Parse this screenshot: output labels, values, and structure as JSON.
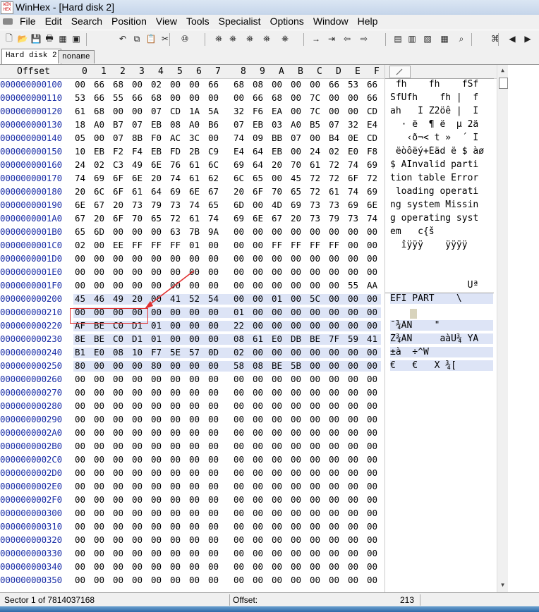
{
  "window": {
    "title": "WinHex - [Hard disk 2]",
    "app_icon_text": "WIN HEX"
  },
  "menu": [
    "File",
    "Edit",
    "Search",
    "Position",
    "View",
    "Tools",
    "Specialist",
    "Options",
    "Window",
    "Help"
  ],
  "tabs": [
    {
      "label": "Hard disk 2",
      "active": true
    },
    {
      "label": "noname",
      "active": false
    }
  ],
  "header": {
    "offset": "Offset",
    "columns": [
      "0",
      "1",
      "2",
      "3",
      "4",
      "5",
      "6",
      "7",
      "8",
      "9",
      "A",
      "B",
      "C",
      "D",
      "E",
      "F"
    ]
  },
  "rows": [
    {
      "offset": "000000000100",
      "bytes": [
        "00",
        "66",
        "68",
        "00",
        "02",
        "00",
        "00",
        "66",
        "68",
        "08",
        "00",
        "00",
        "00",
        "66",
        "53",
        "66"
      ],
      "ascii": " fh    fh    fSf"
    },
    {
      "offset": "000000000110",
      "bytes": [
        "53",
        "66",
        "55",
        "66",
        "68",
        "00",
        "00",
        "00",
        "00",
        "66",
        "68",
        "00",
        "7C",
        "00",
        "00",
        "66"
      ],
      "ascii": "SfUfh    fh |  f"
    },
    {
      "offset": "000000000120",
      "bytes": [
        "61",
        "68",
        "00",
        "00",
        "07",
        "CD",
        "1A",
        "5A",
        "32",
        "F6",
        "EA",
        "00",
        "7C",
        "00",
        "00",
        "CD"
      ],
      "ascii": "ah   Í Z2öê |  Í"
    },
    {
      "offset": "000000000130",
      "bytes": [
        "18",
        "A0",
        "B7",
        "07",
        "EB",
        "08",
        "A0",
        "B6",
        "07",
        "EB",
        "03",
        "A0",
        "B5",
        "07",
        "32",
        "E4"
      ],
      "ascii": "  · ë  ¶ ë  µ 2ä"
    },
    {
      "offset": "000000000140",
      "bytes": [
        "05",
        "00",
        "07",
        "8B",
        "F0",
        "AC",
        "3C",
        "00",
        "74",
        "09",
        "BB",
        "07",
        "00",
        "B4",
        "0E",
        "CD"
      ],
      "ascii": "   ‹ð¬< t »  ´ Í"
    },
    {
      "offset": "000000000150",
      "bytes": [
        "10",
        "EB",
        "F2",
        "F4",
        "EB",
        "FD",
        "2B",
        "C9",
        "E4",
        "64",
        "EB",
        "00",
        "24",
        "02",
        "E0",
        "F8"
      ],
      "ascii": " ëòôëý+Éäd ë $ àø"
    },
    {
      "offset": "000000000160",
      "bytes": [
        "24",
        "02",
        "C3",
        "49",
        "6E",
        "76",
        "61",
        "6C",
        "69",
        "64",
        "20",
        "70",
        "61",
        "72",
        "74",
        "69"
      ],
      "ascii": "$ ÃInvalid parti"
    },
    {
      "offset": "000000000170",
      "bytes": [
        "74",
        "69",
        "6F",
        "6E",
        "20",
        "74",
        "61",
        "62",
        "6C",
        "65",
        "00",
        "45",
        "72",
        "72",
        "6F",
        "72"
      ],
      "ascii": "tion table Error"
    },
    {
      "offset": "000000000180",
      "bytes": [
        "20",
        "6C",
        "6F",
        "61",
        "64",
        "69",
        "6E",
        "67",
        "20",
        "6F",
        "70",
        "65",
        "72",
        "61",
        "74",
        "69"
      ],
      "ascii": " loading operati"
    },
    {
      "offset": "000000000190",
      "bytes": [
        "6E",
        "67",
        "20",
        "73",
        "79",
        "73",
        "74",
        "65",
        "6D",
        "00",
        "4D",
        "69",
        "73",
        "73",
        "69",
        "6E"
      ],
      "ascii": "ng system Missin"
    },
    {
      "offset": "0000000001A0",
      "bytes": [
        "67",
        "20",
        "6F",
        "70",
        "65",
        "72",
        "61",
        "74",
        "69",
        "6E",
        "67",
        "20",
        "73",
        "79",
        "73",
        "74"
      ],
      "ascii": "g operating syst"
    },
    {
      "offset": "0000000001B0",
      "bytes": [
        "65",
        "6D",
        "00",
        "00",
        "00",
        "63",
        "7B",
        "9A",
        "00",
        "00",
        "00",
        "00",
        "00",
        "00",
        "00",
        "00"
      ],
      "ascii": "em   c{š        "
    },
    {
      "offset": "0000000001C0",
      "bytes": [
        "02",
        "00",
        "EE",
        "FF",
        "FF",
        "FF",
        "01",
        "00",
        "00",
        "00",
        "FF",
        "FF",
        "FF",
        "FF",
        "00",
        "00"
      ],
      "ascii": "  îÿÿÿ    ÿÿÿÿ  "
    },
    {
      "offset": "0000000001D0",
      "bytes": [
        "00",
        "00",
        "00",
        "00",
        "00",
        "00",
        "00",
        "00",
        "00",
        "00",
        "00",
        "00",
        "00",
        "00",
        "00",
        "00"
      ],
      "ascii": ""
    },
    {
      "offset": "0000000001E0",
      "bytes": [
        "00",
        "00",
        "00",
        "00",
        "00",
        "00",
        "00",
        "00",
        "00",
        "00",
        "00",
        "00",
        "00",
        "00",
        "00",
        "00"
      ],
      "ascii": ""
    },
    {
      "offset": "0000000001F0",
      "bytes": [
        "00",
        "00",
        "00",
        "00",
        "00",
        "00",
        "00",
        "00",
        "00",
        "00",
        "00",
        "00",
        "00",
        "00",
        "55",
        "AA"
      ],
      "ascii": "              Uª"
    },
    {
      "offset": "000000000200",
      "bytes": [
        "45",
        "46",
        "49",
        "20",
        "00",
        "41",
        "52",
        "54",
        "00",
        "00",
        "01",
        "00",
        "5C",
        "00",
        "00",
        "00"
      ],
      "ascii": "EFI PART    \\   ",
      "hl": true
    },
    {
      "offset": "000000000210",
      "bytes": [
        "00",
        "00",
        "00",
        "00",
        "00",
        "00",
        "00",
        "00",
        "01",
        "00",
        "00",
        "00",
        "00",
        "00",
        "00",
        "00"
      ],
      "ascii": "",
      "hl": true
    },
    {
      "offset": "000000000220",
      "bytes": [
        "AF",
        "BE",
        "C0",
        "D1",
        "01",
        "00",
        "00",
        "00",
        "22",
        "00",
        "00",
        "00",
        "00",
        "00",
        "00",
        "00"
      ],
      "ascii": "¯¾ÀÑ    \"       ",
      "hl": true
    },
    {
      "offset": "000000000230",
      "bytes": [
        "8E",
        "BE",
        "C0",
        "D1",
        "01",
        "00",
        "00",
        "00",
        "08",
        "61",
        "E0",
        "DB",
        "BE",
        "7F",
        "59",
        "41"
      ],
      "ascii": "Ž¾ÀÑ     aàÛ¾ YA",
      "hl": true
    },
    {
      "offset": "000000000240",
      "bytes": [
        "B1",
        "E0",
        "08",
        "10",
        "F7",
        "5E",
        "57",
        "0D",
        "02",
        "00",
        "00",
        "00",
        "00",
        "00",
        "00",
        "00"
      ],
      "ascii": "±à  ÷^W         ",
      "hl": true
    },
    {
      "offset": "000000000250",
      "bytes": [
        "80",
        "00",
        "00",
        "00",
        "80",
        "00",
        "00",
        "00",
        "58",
        "08",
        "BE",
        "5B",
        "00",
        "00",
        "00",
        "00"
      ],
      "ascii": "€   €   X ¾[    ",
      "hl": true
    },
    {
      "offset": "000000000260",
      "bytes": [
        "00",
        "00",
        "00",
        "00",
        "00",
        "00",
        "00",
        "00",
        "00",
        "00",
        "00",
        "00",
        "00",
        "00",
        "00",
        "00"
      ],
      "ascii": ""
    },
    {
      "offset": "000000000270",
      "bytes": [
        "00",
        "00",
        "00",
        "00",
        "00",
        "00",
        "00",
        "00",
        "00",
        "00",
        "00",
        "00",
        "00",
        "00",
        "00",
        "00"
      ],
      "ascii": ""
    },
    {
      "offset": "000000000280",
      "bytes": [
        "00",
        "00",
        "00",
        "00",
        "00",
        "00",
        "00",
        "00",
        "00",
        "00",
        "00",
        "00",
        "00",
        "00",
        "00",
        "00"
      ],
      "ascii": ""
    },
    {
      "offset": "000000000290",
      "bytes": [
        "00",
        "00",
        "00",
        "00",
        "00",
        "00",
        "00",
        "00",
        "00",
        "00",
        "00",
        "00",
        "00",
        "00",
        "00",
        "00"
      ],
      "ascii": ""
    },
    {
      "offset": "0000000002A0",
      "bytes": [
        "00",
        "00",
        "00",
        "00",
        "00",
        "00",
        "00",
        "00",
        "00",
        "00",
        "00",
        "00",
        "00",
        "00",
        "00",
        "00"
      ],
      "ascii": ""
    },
    {
      "offset": "0000000002B0",
      "bytes": [
        "00",
        "00",
        "00",
        "00",
        "00",
        "00",
        "00",
        "00",
        "00",
        "00",
        "00",
        "00",
        "00",
        "00",
        "00",
        "00"
      ],
      "ascii": ""
    },
    {
      "offset": "0000000002C0",
      "bytes": [
        "00",
        "00",
        "00",
        "00",
        "00",
        "00",
        "00",
        "00",
        "00",
        "00",
        "00",
        "00",
        "00",
        "00",
        "00",
        "00"
      ],
      "ascii": ""
    },
    {
      "offset": "0000000002D0",
      "bytes": [
        "00",
        "00",
        "00",
        "00",
        "00",
        "00",
        "00",
        "00",
        "00",
        "00",
        "00",
        "00",
        "00",
        "00",
        "00",
        "00"
      ],
      "ascii": ""
    },
    {
      "offset": "0000000002E0",
      "bytes": [
        "00",
        "00",
        "00",
        "00",
        "00",
        "00",
        "00",
        "00",
        "00",
        "00",
        "00",
        "00",
        "00",
        "00",
        "00",
        "00"
      ],
      "ascii": ""
    },
    {
      "offset": "0000000002F0",
      "bytes": [
        "00",
        "00",
        "00",
        "00",
        "00",
        "00",
        "00",
        "00",
        "00",
        "00",
        "00",
        "00",
        "00",
        "00",
        "00",
        "00"
      ],
      "ascii": ""
    },
    {
      "offset": "000000000300",
      "bytes": [
        "00",
        "00",
        "00",
        "00",
        "00",
        "00",
        "00",
        "00",
        "00",
        "00",
        "00",
        "00",
        "00",
        "00",
        "00",
        "00"
      ],
      "ascii": ""
    },
    {
      "offset": "000000000310",
      "bytes": [
        "00",
        "00",
        "00",
        "00",
        "00",
        "00",
        "00",
        "00",
        "00",
        "00",
        "00",
        "00",
        "00",
        "00",
        "00",
        "00"
      ],
      "ascii": ""
    },
    {
      "offset": "000000000320",
      "bytes": [
        "00",
        "00",
        "00",
        "00",
        "00",
        "00",
        "00",
        "00",
        "00",
        "00",
        "00",
        "00",
        "00",
        "00",
        "00",
        "00"
      ],
      "ascii": ""
    },
    {
      "offset": "000000000330",
      "bytes": [
        "00",
        "00",
        "00",
        "00",
        "00",
        "00",
        "00",
        "00",
        "00",
        "00",
        "00",
        "00",
        "00",
        "00",
        "00",
        "00"
      ],
      "ascii": ""
    },
    {
      "offset": "000000000340",
      "bytes": [
        "00",
        "00",
        "00",
        "00",
        "00",
        "00",
        "00",
        "00",
        "00",
        "00",
        "00",
        "00",
        "00",
        "00",
        "00",
        "00"
      ],
      "ascii": ""
    },
    {
      "offset": "000000000350",
      "bytes": [
        "00",
        "00",
        "00",
        "00",
        "00",
        "00",
        "00",
        "00",
        "00",
        "00",
        "00",
        "00",
        "00",
        "00",
        "00",
        "00"
      ],
      "ascii": ""
    }
  ],
  "status": {
    "sector": "Sector 1 of 7814037168",
    "offset_label": "Offset:",
    "offset_value": "213"
  },
  "colors": {
    "offset_text": "#1b2fa8",
    "highlight": "#dde4f6",
    "annotation": "#e03030"
  },
  "toolbar_icons": [
    "new-file-icon",
    "open-folder-icon",
    "save-icon",
    "print-icon",
    "properties-icon",
    "open-disk-icon",
    "undo-icon",
    "copy-icon",
    "paste-icon",
    "cut-icon",
    "hex-convert-icon",
    "find-icon",
    "find-hex-icon",
    "replace-icon",
    "replace-hex-icon",
    "find-next-icon",
    "goto-offset-icon",
    "goto-sector-icon",
    "back-icon",
    "forward-icon",
    "ram-editor-icon",
    "disk-tools-icon",
    "network-icon",
    "calculator-icon",
    "search-icon",
    "file-recovery-icon",
    "prev-icon",
    "next-icon"
  ]
}
